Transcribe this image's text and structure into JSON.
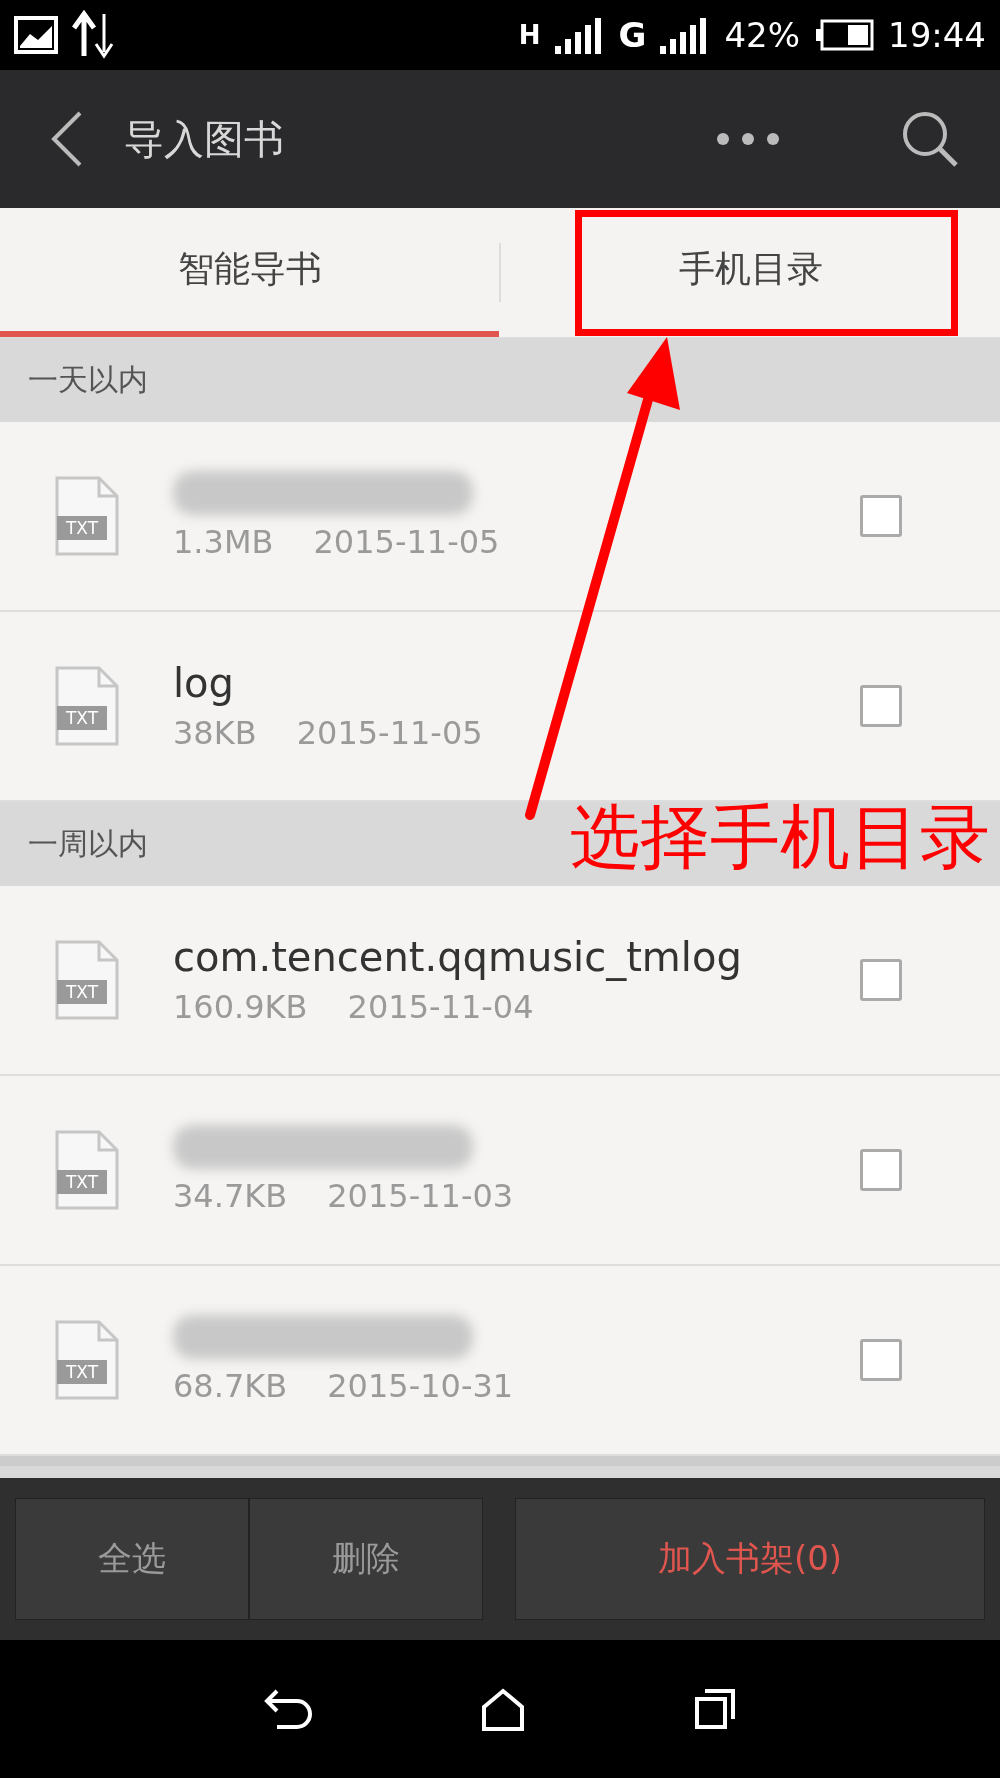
{
  "status_bar": {
    "network_letter": "H",
    "network_type": "G",
    "battery": "42%",
    "time": "19:44"
  },
  "app_bar": {
    "title": "导入图书"
  },
  "tabs": [
    {
      "label": "智能导书",
      "selected": true
    },
    {
      "label": "手机目录",
      "selected": false
    }
  ],
  "sections": [
    {
      "title": "一天以内",
      "files": [
        {
          "kind": "redacted",
          "icon_label": "TXT",
          "size": "1.3MB",
          "date": "2015-11-05",
          "checked": false
        },
        {
          "kind": "named",
          "name": "log",
          "icon_label": "TXT",
          "size": "38KB",
          "date": "2015-11-05",
          "checked": false
        }
      ]
    },
    {
      "title": "一周以内",
      "files": [
        {
          "kind": "named",
          "name": "com.tencent.qqmusic_tmlog",
          "icon_label": "TXT",
          "size": "160.9KB",
          "date": "2015-11-04",
          "checked": false
        },
        {
          "kind": "redacted",
          "icon_label": "TXT",
          "size": "34.7KB",
          "date": "2015-11-03",
          "checked": false
        },
        {
          "kind": "redacted",
          "icon_label": "TXT",
          "size": "68.7KB",
          "date": "2015-10-31",
          "checked": false
        }
      ]
    }
  ],
  "bottom_bar": {
    "select_all": "全选",
    "delete": "删除",
    "add": "加入书架(0)"
  },
  "annotation": {
    "text": "选择手机目录"
  }
}
